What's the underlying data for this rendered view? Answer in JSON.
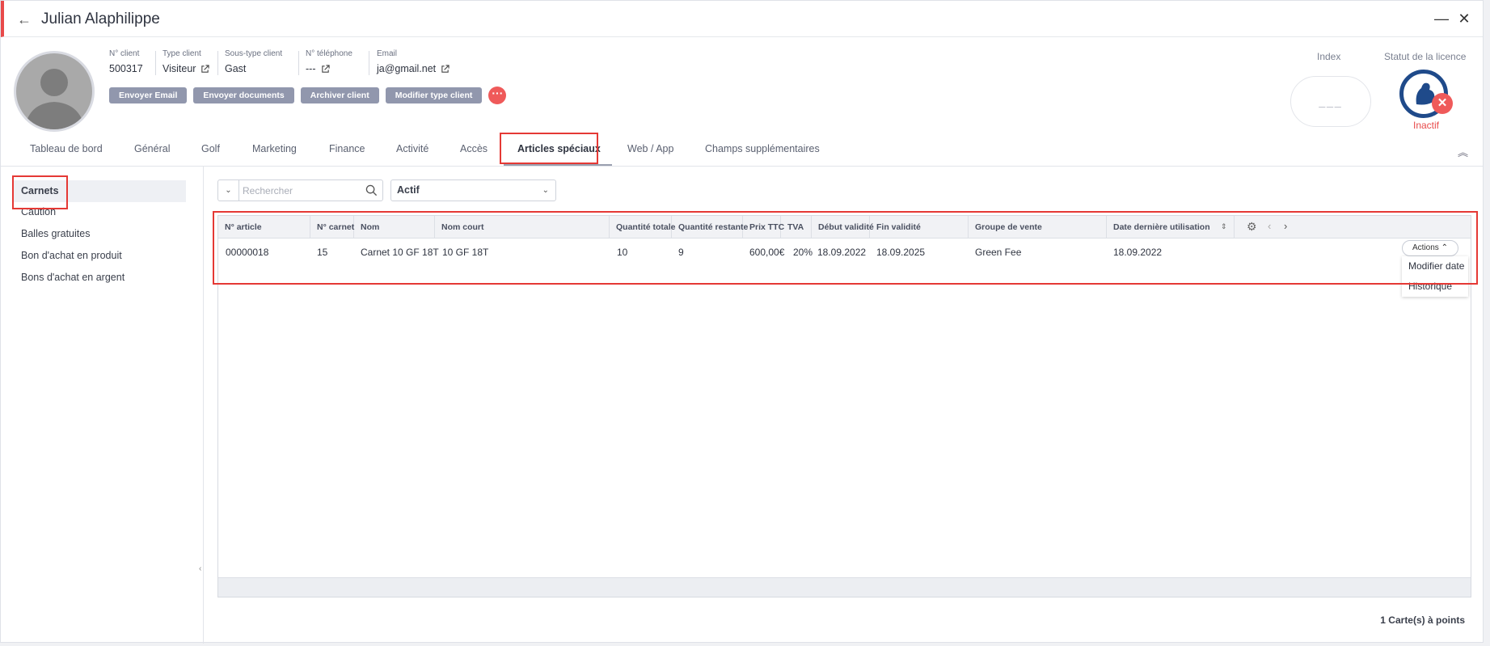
{
  "window": {
    "title": "Julian Alaphilippe"
  },
  "client": {
    "fields": [
      {
        "label": "N° client",
        "value": "500317",
        "ext": false
      },
      {
        "label": "Type client",
        "value": "Visiteur",
        "ext": true
      },
      {
        "label": "Sous-type client",
        "value": "Gast",
        "ext": false
      },
      {
        "label": "N° téléphone",
        "value": "---",
        "ext": true
      },
      {
        "label": "Email",
        "value": "ja@gmail.net",
        "ext": true
      }
    ],
    "buttons": [
      "Envoyer Email",
      "Envoyer documents",
      "Archiver client",
      "Modifier type client"
    ],
    "more_icon": "···",
    "index_label": "Index",
    "index_value": "___",
    "license_label": "Statut de la licence",
    "license_status": "Inactif",
    "colors": {
      "accent": "#e84a4a",
      "button": "#9197ad",
      "license_ring": "#1f4a8a"
    }
  },
  "tabs": [
    "Tableau de bord",
    "Général",
    "Golf",
    "Marketing",
    "Finance",
    "Activité",
    "Accès",
    "Articles spéciaux",
    "Web / App",
    "Champs supplémentaires"
  ],
  "active_tab": "Articles spéciaux",
  "sidebar": [
    "Carnets",
    "Caution",
    "Balles gratuites",
    "Bon d'achat en produit",
    "Bons d'achat en argent"
  ],
  "filters": {
    "search_placeholder": "Rechercher",
    "status": "Actif"
  },
  "table": {
    "columns": [
      "N° article",
      "N° carnet",
      "Nom",
      "Nom court",
      "Quantité totale",
      "Quantité restante",
      "Prix TTC",
      "TVA",
      "Début validité",
      "Fin validité",
      "Groupe de vente",
      "Date dernière utilisation"
    ],
    "rows": [
      [
        "00000018",
        "15",
        "Carnet 10 GF 18T",
        "10 GF 18T",
        "10",
        "9",
        "600,00€",
        "20%",
        "18.09.2022",
        "18.09.2025",
        "Green Fee",
        "18.09.2022"
      ]
    ],
    "actions_label": "Actions",
    "menu": [
      "Modifier date",
      "Historique"
    ]
  },
  "footer": {
    "count": "1 Carte(s) à points"
  }
}
